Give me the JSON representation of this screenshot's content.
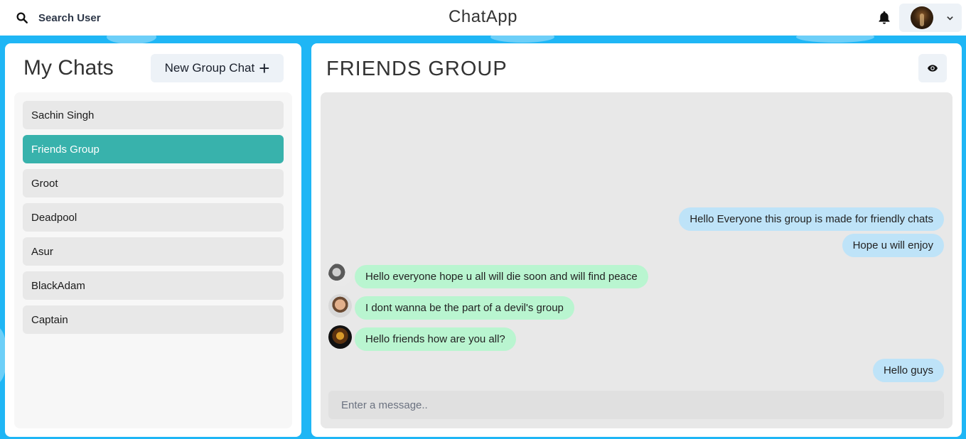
{
  "header": {
    "search_label": "Search User",
    "app_title": "ChatApp",
    "icons": [
      "search-icon",
      "bell-icon",
      "chevron-down-icon"
    ]
  },
  "sidebar": {
    "title": "My Chats",
    "new_group_label": "New Group Chat",
    "new_group_icon": "+",
    "chats": [
      {
        "name": "Sachin Singh",
        "active": false
      },
      {
        "name": "Friends Group",
        "active": true
      },
      {
        "name": "Groot",
        "active": false
      },
      {
        "name": "Deadpool",
        "active": false
      },
      {
        "name": "Asur",
        "active": false
      },
      {
        "name": "BlackAdam",
        "active": false
      },
      {
        "name": "Captain",
        "active": false
      }
    ]
  },
  "conversation": {
    "title": "FRIENDS GROUP",
    "view_icon": "eye-icon",
    "messages": [
      {
        "text": "Hello Everyone this group is made for friendly chats",
        "mine": true
      },
      {
        "text": "Hope u will enjoy",
        "mine": true
      },
      {
        "text": "Hello everyone hope u all will die soon and will find peace",
        "mine": false
      },
      {
        "text": "I dont wanna be the part of a devil's group",
        "mine": false
      },
      {
        "text": "Hello friends how are you all?",
        "mine": false
      },
      {
        "text": "Hello guys",
        "mine": true
      }
    ],
    "input_placeholder": "Enter a message.."
  },
  "colors": {
    "background": "#1fb6f5",
    "active_chat": "#38b2ac",
    "my_bubble": "#bee3f8",
    "other_bubble": "#b9f5d0"
  }
}
